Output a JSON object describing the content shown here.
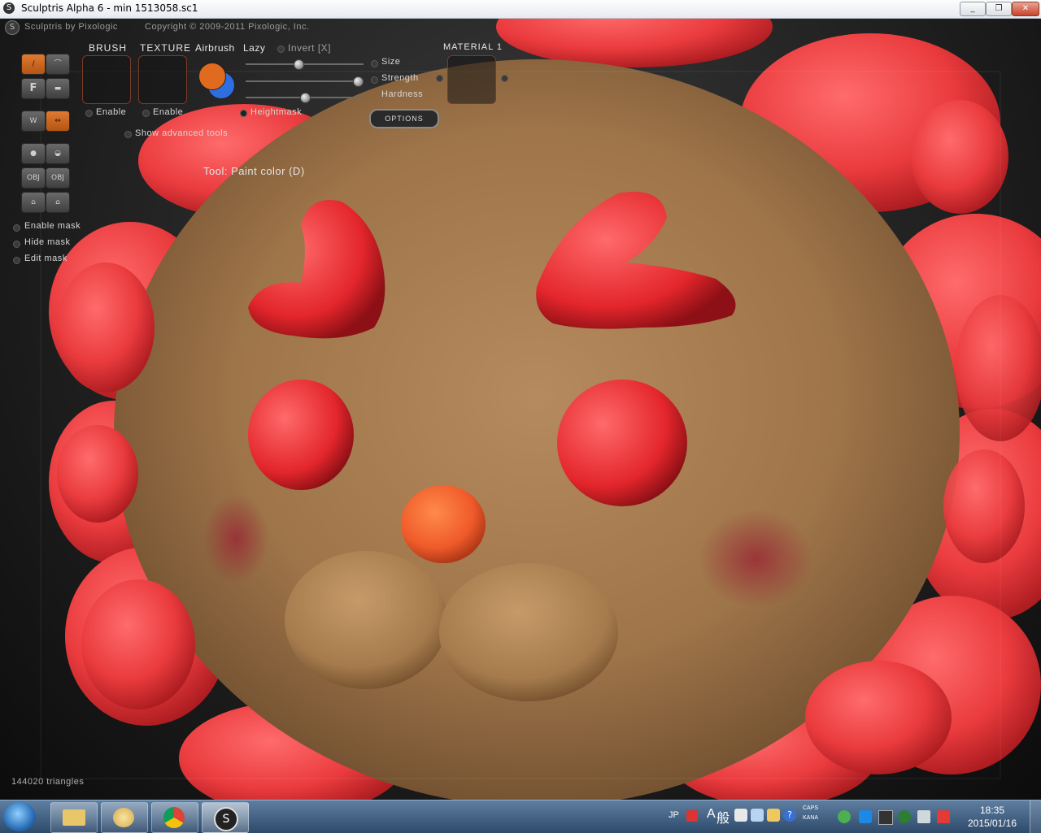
{
  "window": {
    "title": "Sculptris Alpha 6 - min 1513058.sc1",
    "minimize": "_",
    "maximize": "❐",
    "close": "✕"
  },
  "app": {
    "header_brand": "Sculptris by Pixologic",
    "header_copyright": "Copyright © 2009-2011 Pixologic, Inc."
  },
  "toolbar": {
    "brush_label": "BRUSH",
    "texture_label": "TEXTURE",
    "airbrush_label": "Airbrush",
    "lazy_label": "Lazy",
    "invert_label": "Invert [X]",
    "material_label": "MATERIAL 1",
    "brush_enable": "Enable",
    "texture_enable": "Enable",
    "heightmask_label": "Heightmask",
    "size_label": "Size",
    "strength_label": "Strength",
    "hardness_label": "Hardness",
    "options_label": "OPTIONS",
    "show_advanced": "Show advanced tools",
    "tool_status": "Tool: Paint color (D)",
    "primary_color": "#e06a1e",
    "secondary_color": "#2f6ee0",
    "size_value": 0.45,
    "strength_value": 0.95,
    "hardness_value": 0.5
  },
  "left_tools": {
    "flatten_label": "F",
    "obj1": "OBJ",
    "obj2": "OBJ",
    "enable_mask": "Enable mask",
    "hide_mask": "Hide mask",
    "edit_mask": "Edit mask"
  },
  "status": {
    "triangles": "144020 triangles"
  },
  "taskbar": {
    "lang": "JP",
    "ime_a": "A",
    "ime_kanji": "般",
    "caps": "CAPS",
    "kana": "KANA",
    "time": "18:35",
    "date": "2015/01/16"
  }
}
